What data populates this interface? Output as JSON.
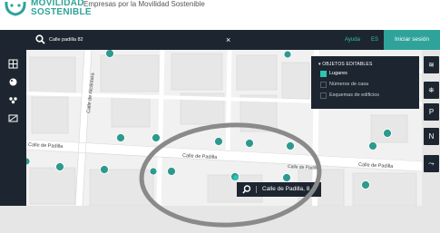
{
  "brand": {
    "line1": "MOVILIDAD",
    "line2": "SOSTENIBLE",
    "tagline": "Empresas por la Movilidad Sostenible",
    "color": "#2fa39a"
  },
  "topbar": {
    "search_value": "Calle padilla 82",
    "close_symbol": "×",
    "help_label": "Ayuda",
    "language_label": "ES",
    "login_label": "Iniciar sesión",
    "background": "#1d2630",
    "accent": "#2fc2b5"
  },
  "left_toolbar": {
    "items": [
      {
        "icon": "grid-icon"
      },
      {
        "icon": "palette-icon"
      },
      {
        "icon": "group-icon"
      },
      {
        "icon": "image-icon"
      }
    ]
  },
  "right_toolbar": {
    "items": [
      {
        "icon": "layers-icon",
        "glyph": "≋"
      },
      {
        "icon": "add-bike-icon",
        "glyph": "⛯"
      },
      {
        "icon": "add-parking-icon",
        "glyph": "P"
      },
      {
        "icon": "add-number-icon",
        "glyph": "N"
      },
      {
        "icon": "add-route-icon",
        "glyph": "⤳"
      }
    ]
  },
  "layers_panel": {
    "title": "▾ OBJETOS EDITABLES",
    "options": [
      {
        "label": "Lugares",
        "checked": true
      },
      {
        "label": "Números de casa",
        "checked": false
      },
      {
        "label": "Esquemas de edificios",
        "checked": false
      }
    ]
  },
  "map": {
    "street_labels": [
      "Calle de Alcántara",
      "Calle de Padilla",
      "Calle de Padilla",
      "Calle de Padilla",
      "Calle de Padilla"
    ],
    "poi_color": "#2e9a8f"
  },
  "search_result": {
    "label": "Calle de Padilla, 8"
  }
}
